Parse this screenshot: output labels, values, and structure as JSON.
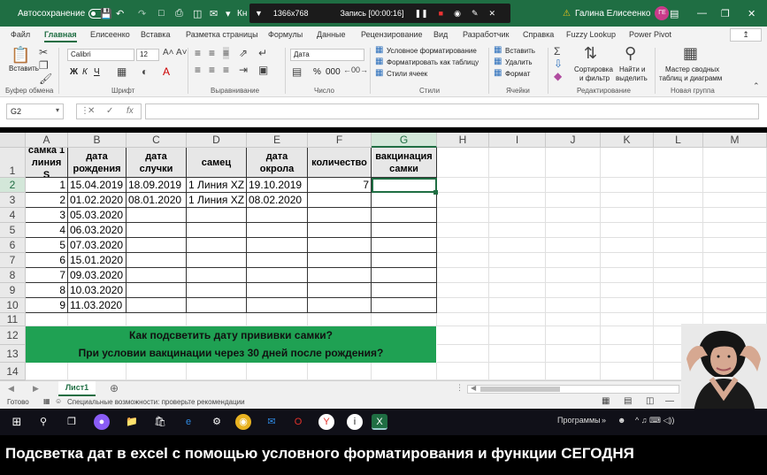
{
  "titlebar": {
    "autosave_label": "Автосохранение",
    "autosave_state": "off",
    "file_name_fragment": "Кн",
    "recorder": {
      "resolution": "1366x768",
      "status": "Запись [00:00:16]"
    },
    "warning_icon": "warning-icon",
    "user_name": "Галина Елисеенко",
    "user_initials": "ГЕ",
    "bg_color": "#1f6e43"
  },
  "tabs": [
    "Файл",
    "Главная",
    "Елисеенко",
    "Вставка",
    "Разметка страницы",
    "Формулы",
    "Данные",
    "Рецензирование",
    "Вид",
    "Разработчик",
    "Справка",
    "Fuzzy Lookup",
    "Power Pivot"
  ],
  "active_tab": "Главная",
  "ribbon": {
    "clipboard": {
      "paste": "Вставить",
      "label": "Буфер обмена"
    },
    "font": {
      "name": "Calibri",
      "size": "12",
      "bold": "Ж",
      "italic": "К",
      "underline": "Ч",
      "label": "Шрифт"
    },
    "alignment": {
      "label": "Выравнивание"
    },
    "number": {
      "format": "Дата",
      "percent": "%",
      "thousands": "000",
      "label": "Число"
    },
    "styles": {
      "cond_format": "Условное форматирование",
      "format_table": "Форматировать как таблицу",
      "cell_styles": "Стили ячеек",
      "label": "Стили"
    },
    "cells": {
      "insert": "Вставить",
      "delete": "Удалить",
      "format": "Формат",
      "label": "Ячейки"
    },
    "editing": {
      "sort": "Сортировка",
      "filter": "и фильтр",
      "find": "Найти и",
      "select": "выделить",
      "label": "Редактирование"
    },
    "new_group": {
      "line1": "Мастер сводных",
      "line2": "таблиц и диаграмм",
      "label": "Новая группа"
    }
  },
  "formula_bar": {
    "name_box": "G2",
    "fx": "fx",
    "value": ""
  },
  "columns": [
    "A",
    "B",
    "C",
    "D",
    "E",
    "F",
    "G",
    "H",
    "I",
    "J",
    "K",
    "L",
    "M"
  ],
  "selected_column": "G",
  "rows": [
    "1",
    "2",
    "3",
    "4",
    "5",
    "6",
    "7",
    "8",
    "9",
    "10",
    "11",
    "12",
    "13",
    "14"
  ],
  "selected_row": "2",
  "headers": {
    "a": "самка 1 линия S",
    "b": "дата рождения",
    "c": "дата случки",
    "d": "самец",
    "e": "дата окрола",
    "f": "количество",
    "g": "вакцинация самки"
  },
  "table_rows": [
    {
      "a": "1",
      "b": "15.04.2019",
      "c": "18.09.2019",
      "d": "1 Линия XZ",
      "e": "19.10.2019",
      "f": "7"
    },
    {
      "a": "2",
      "b": "01.02.2020",
      "c": "08.01.2020",
      "d": "1 Линия XZ",
      "e": "08.02.2020",
      "f": ""
    },
    {
      "a": "3",
      "b": "05.03.2020",
      "c": "",
      "d": "",
      "e": "",
      "f": ""
    },
    {
      "a": "4",
      "b": "06.03.2020",
      "c": "",
      "d": "",
      "e": "",
      "f": ""
    },
    {
      "a": "5",
      "b": "07.03.2020",
      "c": "",
      "d": "",
      "e": "",
      "f": ""
    },
    {
      "a": "6",
      "b": "15.01.2020",
      "c": "",
      "d": "",
      "e": "",
      "f": ""
    },
    {
      "a": "7",
      "b": "09.03.2020",
      "c": "",
      "d": "",
      "e": "",
      "f": ""
    },
    {
      "a": "8",
      "b": "10.03.2020",
      "c": "",
      "d": "",
      "e": "",
      "f": ""
    },
    {
      "a": "9",
      "b": "11.03.2020",
      "c": "",
      "d": "",
      "e": "",
      "f": ""
    }
  ],
  "banner": {
    "line1": "Как подсветить дату прививки самки?",
    "line2": "При условии вакцинации через 30 дней после рождения?",
    "color": "#1fa153"
  },
  "sheet_tab": "Лист1",
  "status": {
    "ready": "Готово",
    "accessibility": "Специальные возможности: проверьте рекомендации"
  },
  "taskbar": {
    "programs": "Программы",
    "tray": "^ ♫ ⌨ ◁))"
  },
  "video_title": "Подсветка дат в excel с помощью условного форматирования и функции СЕГОДНЯ"
}
